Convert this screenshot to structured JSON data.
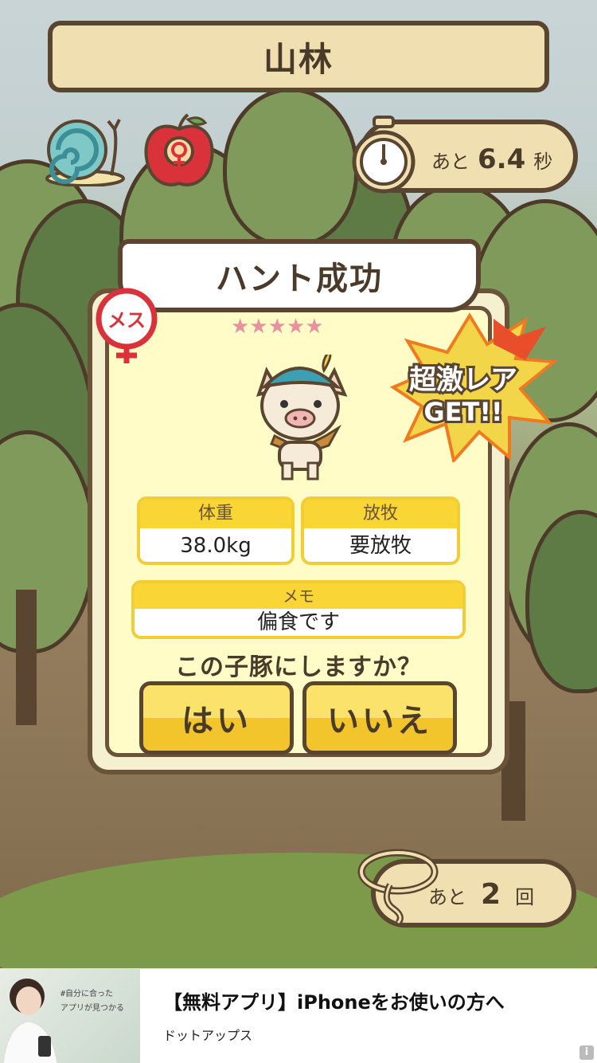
{
  "location_title": "山林",
  "timer": {
    "prefix": "あと",
    "value": "6.4",
    "suffix": "秒"
  },
  "dialog": {
    "title": "ハント成功",
    "stars": "★★★★★",
    "gender_label": "メス",
    "rare_badge_line1": "超激レア",
    "rare_badge_line2": "GET!!",
    "weight": {
      "label": "体重",
      "value": "38.0kg"
    },
    "ranch": {
      "label": "放牧",
      "value": "要放牧"
    },
    "memo": {
      "label": "メモ",
      "value": "偏食です"
    },
    "question": "この子豚にしますか？",
    "yes_label": "はい",
    "no_label": "いいえ"
  },
  "remaining": {
    "prefix": "あと",
    "value": "2",
    "suffix": "回"
  },
  "ad": {
    "image_copy_line1": "#自分に合った",
    "image_copy_line2": "アプリが見つかる",
    "title": "【無料アプリ】iPhoneをお使いの方へ",
    "advertiser": "ドットアップス",
    "info_glyph": "i"
  },
  "colors": {
    "plank_bg": "#f0e0b1",
    "dialog_bg": "#fffcc8",
    "button_yellow": "#fbe26b",
    "stat_header": "#f9d635",
    "border_brown": "#5a4530",
    "star_pink": "#e7929d"
  }
}
